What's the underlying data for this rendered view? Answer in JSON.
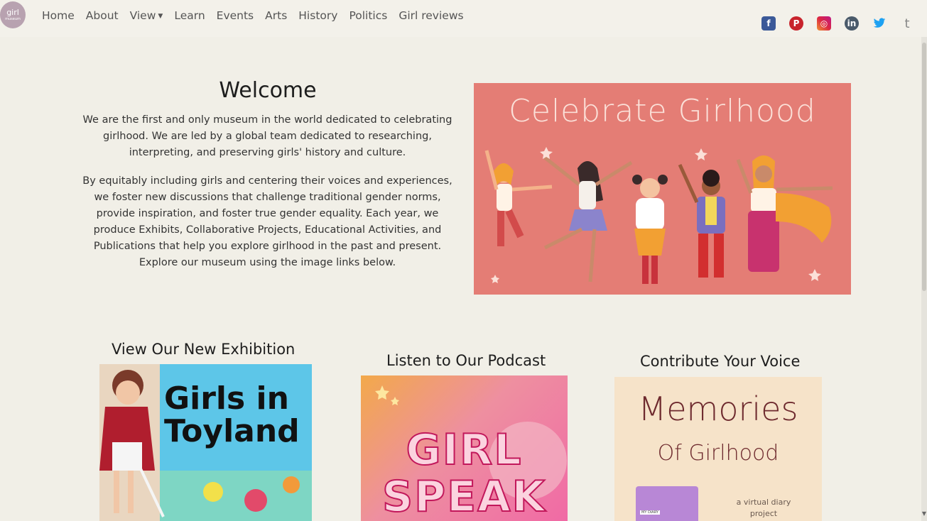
{
  "logo": {
    "line1": "girl",
    "line2": "museum"
  },
  "nav": {
    "home": "Home",
    "about": "About",
    "view": "View",
    "learn": "Learn",
    "events": "Events",
    "arts": "Arts",
    "history": "History",
    "politics": "Politics",
    "girl_reviews": "Girl reviews"
  },
  "social": {
    "facebook": "f",
    "pinterest": "P",
    "instagram": "◎",
    "linkedin": "in",
    "twitter": "🐦",
    "tumblr": "t"
  },
  "welcome": {
    "title": "Welcome",
    "p1": "We are the first and only museum in the world dedicated to celebrating girlhood. We are led by a global team dedicated to researching, interpreting, and preserving girls' history and culture.",
    "p2": "By equitably including girls and centering their voices and experiences, we foster new discussions that challenge traditional gender norms, provide inspiration, and foster true gender equality. Each year, we produce Exhibits, Collaborative Projects, Educational Activities, and Publications that help you explore girlhood in the past and present. Explore our museum using the image links below."
  },
  "hero": {
    "title": "Celebrate Girlhood",
    "bg_color": "#e47d75"
  },
  "sections": [
    {
      "title": "View Our New Exhibition",
      "image_text": "Girls in Toyland"
    },
    {
      "title": "Listen to Our Podcast",
      "image_text_1": "GIRL",
      "image_text_2": "SPEAK"
    },
    {
      "title": "Contribute Your Voice",
      "image_title": "Memories",
      "image_sub": "Of Girlhood",
      "image_note": "a virtual diary project",
      "diary_label": "MY DIARY"
    }
  ]
}
